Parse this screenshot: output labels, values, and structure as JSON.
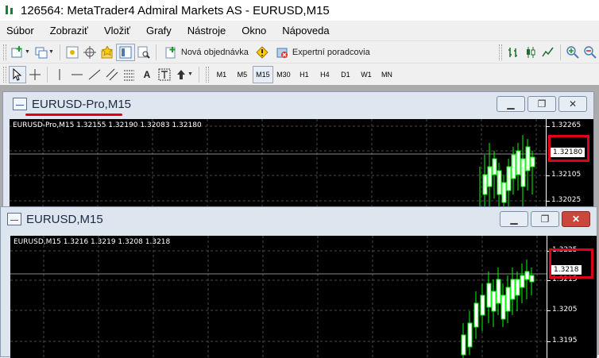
{
  "app": {
    "title": "126564: MetaTrader4 Admiral Markets AS - EURUSD,M15"
  },
  "menu": [
    "Súbor",
    "Zobraziť",
    "Vložiť",
    "Grafy",
    "Nástroje",
    "Okno",
    "Nápoveda"
  ],
  "toolbar1": {
    "new_order_label": "Nová objednávka",
    "expert_advisors_label": "Expertní poradcovia"
  },
  "timeframes": [
    "M1",
    "M5",
    "M15",
    "M30",
    "H1",
    "H4",
    "D1",
    "W1",
    "MN"
  ],
  "active_timeframe": "M15",
  "windows": [
    {
      "title": "EURUSD-Pro,M15",
      "info": "EURUSD-Pro,M15  1.32155 1.32190 1.32083 1.32180",
      "price_ticks": [
        "1.32265",
        "1.32105",
        "1.32025"
      ],
      "current_price": "1.32180"
    },
    {
      "title": "EURUSD,M15",
      "info": "EURUSD,M15  1.3216 1.3219 1.3208 1.3218",
      "price_ticks": [
        "1.3225",
        "1.3215",
        "1.3205",
        "1.3195"
      ],
      "current_price": "1.3218"
    }
  ],
  "colors": {
    "highlight": "#e0001a",
    "candle": "#00ff00",
    "chart_bg": "#000000",
    "grid": "#4a4a4a"
  }
}
